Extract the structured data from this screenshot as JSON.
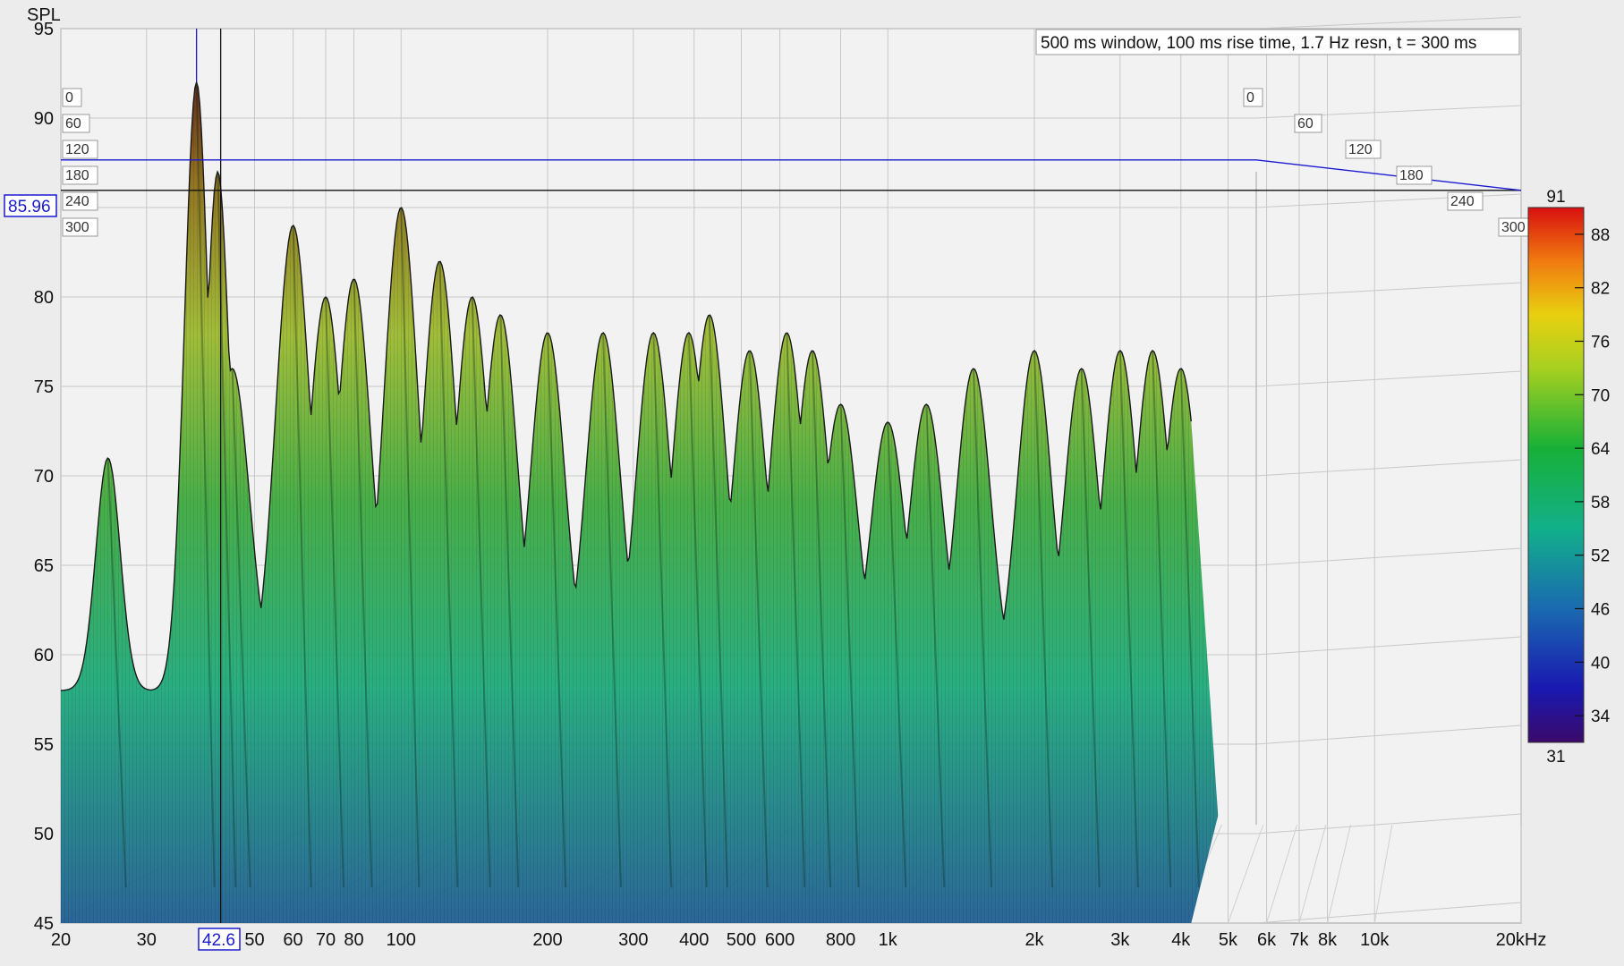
{
  "chart_data": {
    "type": "waterfall",
    "title": "500 ms window, 100 ms rise time,  1.7 Hz resn, t = 300 ms",
    "ylabel": "SPL",
    "xunit": "kHz",
    "ylim": [
      45,
      95
    ],
    "yticks": [
      95,
      90,
      85,
      80,
      75,
      70,
      65,
      60,
      55,
      50,
      45
    ],
    "x_scale": "log",
    "xlim": [
      20,
      20000
    ],
    "xticks": [
      {
        "v": 20,
        "label": "20"
      },
      {
        "v": 30,
        "label": "30"
      },
      {
        "v": 50,
        "label": "50"
      },
      {
        "v": 60,
        "label": "60"
      },
      {
        "v": 70,
        "label": "70"
      },
      {
        "v": 80,
        "label": "80"
      },
      {
        "v": 100,
        "label": "100"
      },
      {
        "v": 200,
        "label": "200"
      },
      {
        "v": 300,
        "label": "300"
      },
      {
        "v": 400,
        "label": "400"
      },
      {
        "v": 500,
        "label": "500"
      },
      {
        "v": 600,
        "label": "600"
      },
      {
        "v": 800,
        "label": "800"
      },
      {
        "v": 1000,
        "label": "1k"
      },
      {
        "v": 2000,
        "label": "2k"
      },
      {
        "v": 3000,
        "label": "3k"
      },
      {
        "v": 4000,
        "label": "4k"
      },
      {
        "v": 5000,
        "label": "5k"
      },
      {
        "v": 6000,
        "label": "6k"
      },
      {
        "v": 7000,
        "label": "7k"
      },
      {
        "v": 8000,
        "label": "8k"
      },
      {
        "v": 10000,
        "label": "10k"
      },
      {
        "v": 20000,
        "label": "20kHz"
      }
    ],
    "time_axis_ms": [
      "0",
      "60",
      "120",
      "180",
      "240",
      "300"
    ],
    "cursor": {
      "freq": "42.6",
      "spl": "85.96"
    },
    "colorbar": {
      "min": 31,
      "max": 91,
      "min_label": "31",
      "max_label": "91",
      "ticks": [
        "88",
        "82",
        "76",
        "70",
        "64",
        "58",
        "52",
        "46",
        "40",
        "34"
      ]
    },
    "peak_frequencies_hz": [
      25,
      38,
      42,
      45,
      60,
      70,
      80,
      100,
      120,
      140,
      160,
      200,
      260,
      330,
      390,
      430,
      520,
      620,
      700,
      800,
      1000,
      1200,
      1500,
      2000,
      2500,
      3000,
      3500,
      4000
    ],
    "peak_levels_db": [
      71,
      92,
      87,
      76,
      84,
      80,
      81,
      85,
      82,
      80,
      79,
      78,
      78,
      78,
      78,
      79,
      77,
      78,
      77,
      74,
      73,
      74,
      76,
      77,
      76,
      77,
      77,
      76
    ],
    "colors": {
      "surface_high": "#7a2a10",
      "surface_mid": "#5aa82a",
      "surface_low": "#1f7fa0",
      "cursor": "#1a1ad0"
    }
  }
}
